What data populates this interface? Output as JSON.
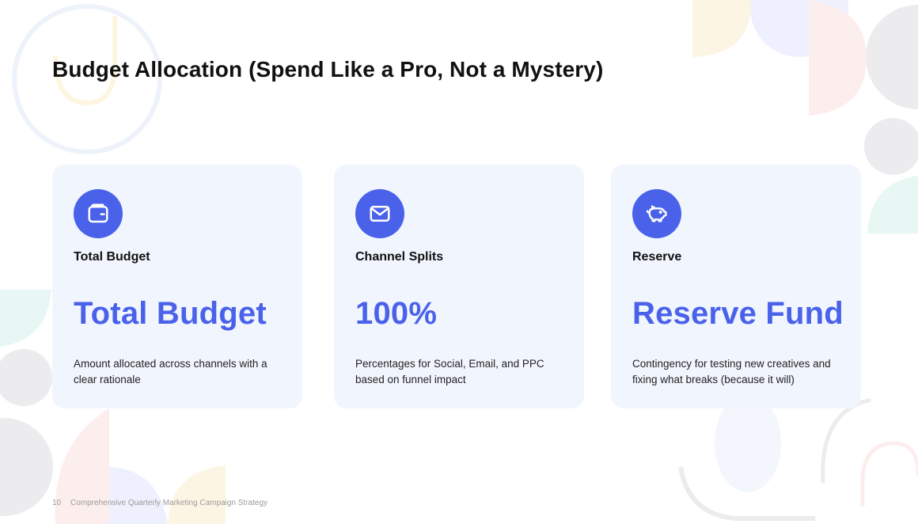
{
  "slide": {
    "title": "Budget Allocation (Spend Like a Pro, Not a Mystery)",
    "page_number": "10",
    "footer": "Comprehensive Quarterly Marketing Campaign Strategy"
  },
  "cards": [
    {
      "icon": "wallet-icon",
      "label": "Total Budget",
      "value": "Total Budget",
      "description": "Amount allocated across channels with a clear rationale"
    },
    {
      "icon": "mail-icon",
      "label": "Channel Splits",
      "value": "100%",
      "description": "Percentages for Social, Email, and PPC based on funnel impact"
    },
    {
      "icon": "piggy-bank-icon",
      "label": "Reserve",
      "value": "Reserve Fund",
      "description": "Contingency for testing new creatives and fixing what breaks (because it will)"
    }
  ],
  "colors": {
    "accent": "#4a62ea",
    "card_background": "#f1f5fe",
    "text": "#111111"
  }
}
